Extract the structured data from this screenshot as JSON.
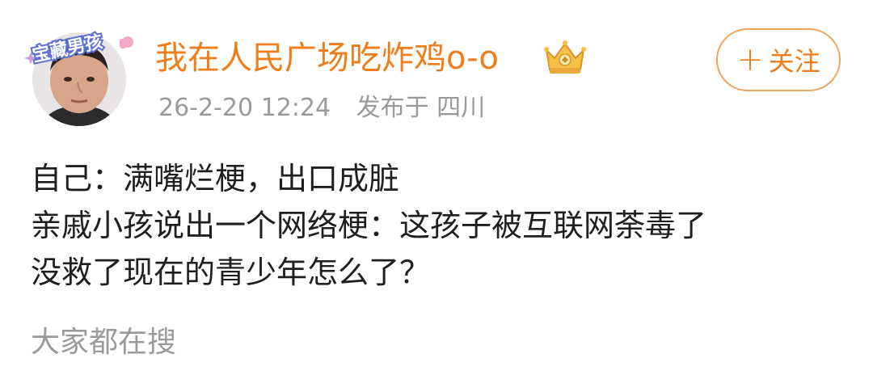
{
  "post": {
    "author": {
      "name": "我在人民广场吃炸鸡o-o",
      "avatar_badge_text": "宝藏男孩",
      "badge_icon": "crown-vip-icon"
    },
    "timestamp": "26-2-20 12:24",
    "location": "发布于 四川",
    "follow_label": "关注",
    "follow_icon": "plus-icon",
    "content_lines": [
      "自己：满嘴烂梗，出口成脏",
      "亲戚小孩说出一个网络梗：这孩子被互联网荼毒了",
      "没救了现在的青少年怎么了？"
    ]
  },
  "search_hint": "大家都在搜",
  "colors": {
    "accent": "#ef7d1c",
    "follow_border": "#f0a35a",
    "meta_text": "#9a9a9a",
    "body_text": "#1f1f1f"
  }
}
